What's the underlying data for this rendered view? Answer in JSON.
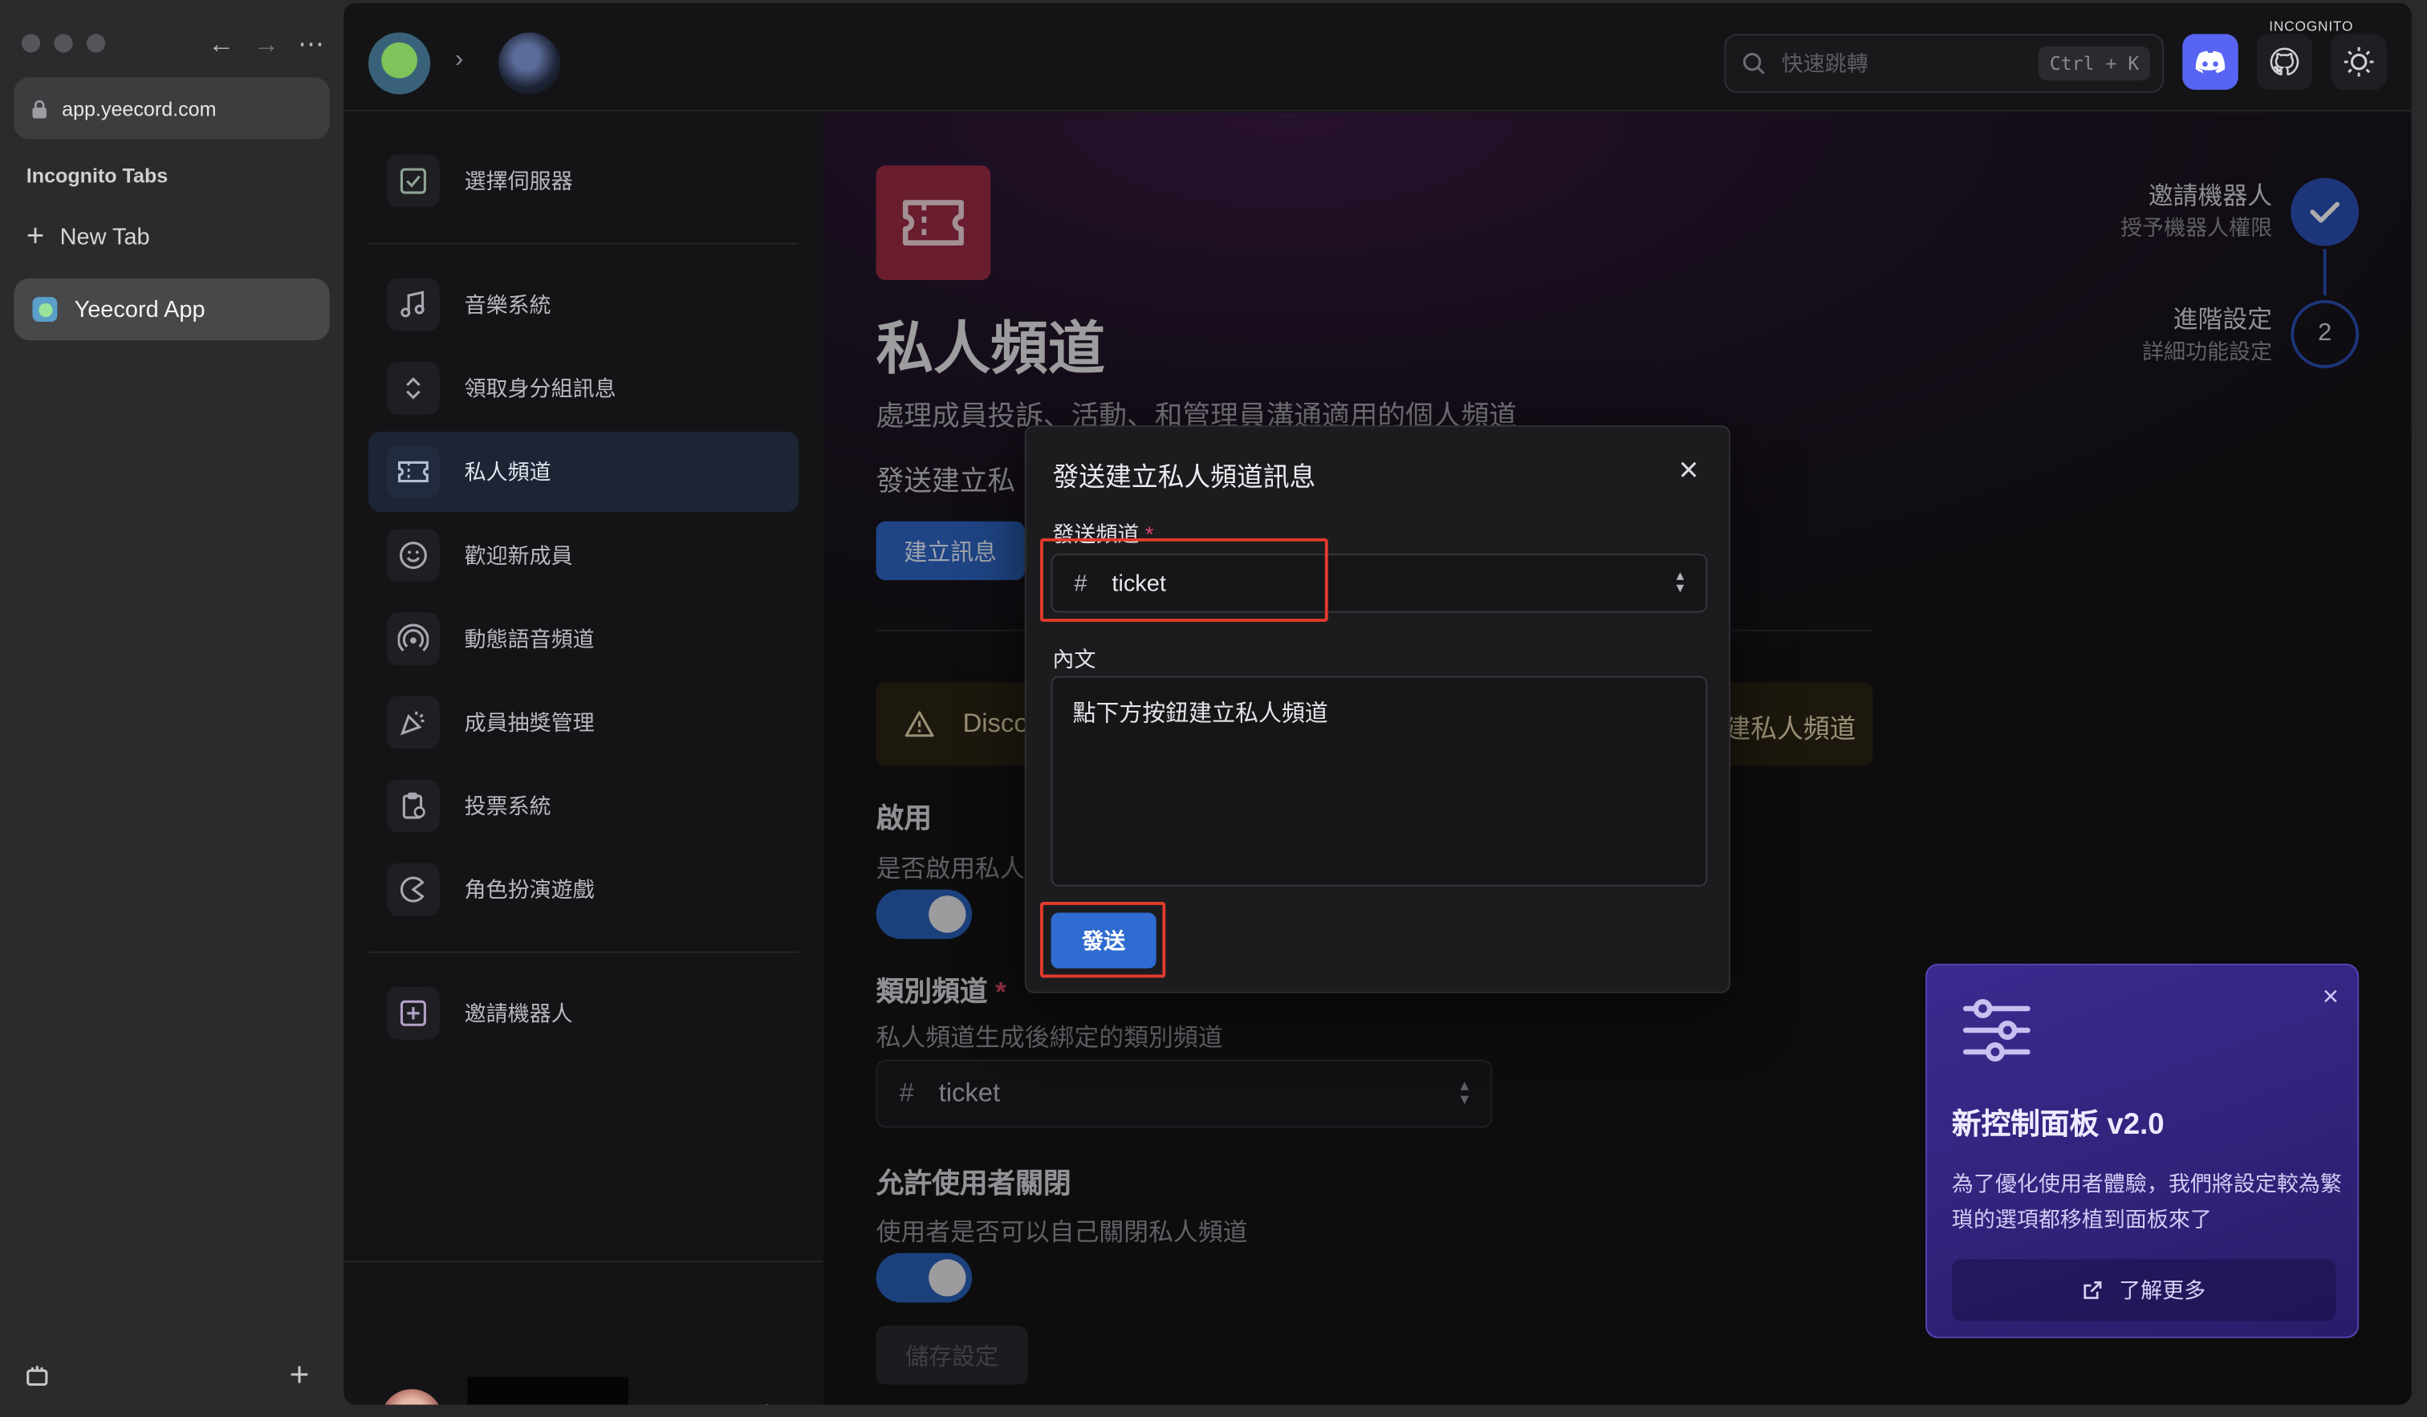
{
  "browser": {
    "url": "app.yeecord.com",
    "section_title": "Incognito Tabs",
    "new_tab_label": "New Tab",
    "active_tab_label": "Yeecord App",
    "incognito_badge": "INCOGNITO"
  },
  "topbar": {
    "search_placeholder": "快速跳轉",
    "shortcut": "Ctrl + K",
    "icons": [
      "discord-icon",
      "github-icon",
      "sun-icon"
    ]
  },
  "sidebar": {
    "select_server": "選擇伺服器",
    "items": [
      {
        "label": "音樂系統",
        "icon": "music-icon"
      },
      {
        "label": "領取身分組訊息",
        "icon": "chevron-updown-icon"
      },
      {
        "label": "私人頻道",
        "icon": "ticket-icon",
        "active": true
      },
      {
        "label": "歡迎新成員",
        "icon": "smile-icon"
      },
      {
        "label": "動態語音頻道",
        "icon": "broadcast-icon"
      },
      {
        "label": "成員抽獎管理",
        "icon": "party-icon"
      },
      {
        "label": "投票系統",
        "icon": "clipboard-icon"
      },
      {
        "label": "角色扮演遊戲",
        "icon": "pacman-icon"
      }
    ],
    "invite_bot": "邀請機器人"
  },
  "main": {
    "title": "私人頻道",
    "description": "處理成員投訴、活動、和管理員溝通適用的個人頻道",
    "send_section_title": "發送建立私",
    "create_message_button": "建立訊息",
    "warning_start": "Disco",
    "warning_end": "建私人頻道",
    "enable_title": "啟用",
    "enable_desc": "是否啟用私人",
    "enable_on": true,
    "category_title": "類別頻道",
    "category_desc": "私人頻道生成後綁定的類別頻道",
    "category_value": "ticket",
    "allow_close_title": "允許使用者關閉",
    "allow_close_desc": "使用者是否可以自己關閉私人頻道",
    "allow_close_on": true,
    "save_button": "儲存設定"
  },
  "stepper": {
    "steps": [
      {
        "title": "邀請機器人",
        "subtitle": "授予機器人權限",
        "done": true
      },
      {
        "title": "進階設定",
        "subtitle": "詳細功能設定",
        "number": "2"
      }
    ]
  },
  "promo": {
    "title": "新控制面板 v2.0",
    "text": "為了優化使用者體驗，我們將設定較為繁瑣的選項都移植到面板來了",
    "button": "了解更多"
  },
  "modal": {
    "title": "發送建立私人頻道訊息",
    "channel_label": "發送頻道",
    "channel_required": "*",
    "channel_value": "ticket",
    "content_label": "內文",
    "content_value": "點下方按鈕建立私人頻道",
    "send_button": "發送"
  },
  "colors": {
    "accent": "#2f6bd0",
    "highlight": "#e23b2c",
    "ticket_icon_bg": "#9b2b45",
    "promo_bg": "#3c2a8f"
  }
}
